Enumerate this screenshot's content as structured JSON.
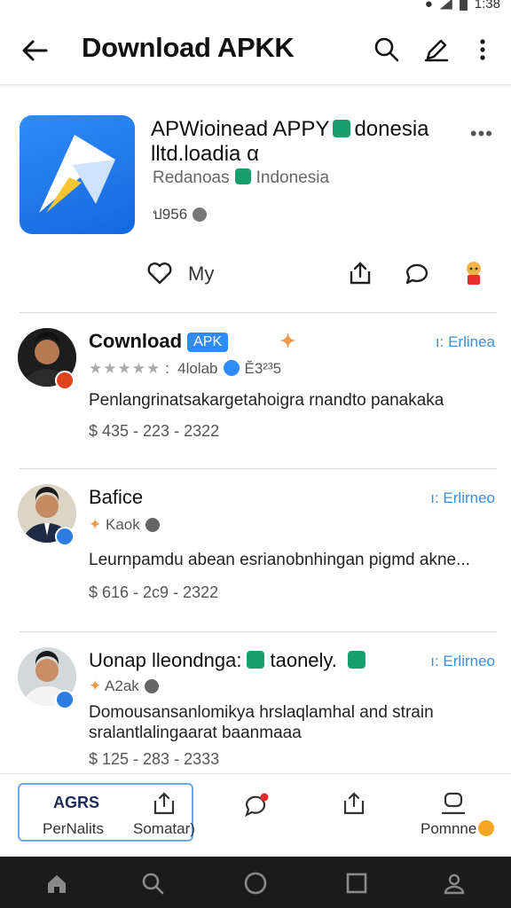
{
  "status_bar": {
    "time": "1:38"
  },
  "header": {
    "title": "Download APKK",
    "icons": [
      "back-arrow-icon",
      "search-icon",
      "edit-pen-icon",
      "more-vert-icon"
    ]
  },
  "app": {
    "name_line1": "APWioinead APPY",
    "name_line1_suffix": "donesia",
    "name_line2": "lltd.loadia α",
    "publisher": "Redanoas",
    "region": "Indonesia",
    "count": "ป956",
    "more": "•••",
    "action_my": "My"
  },
  "posts": [
    {
      "name": "Cownload",
      "pill": "APK",
      "tag": "ı: Erlinea",
      "rating_suffix": ":",
      "meta_user": "4lolab",
      "meta_count": "ง3 3",
      "meta_count_text": "Ĕ3²³5",
      "body": "Penlangrinatsakargetahoigra rnandto panakaka",
      "price": "$ 435 - 223 - 2322",
      "accent": "#e0441e"
    },
    {
      "name": "Bafice",
      "tag": "ı: Erlirneo",
      "meta_user": "Kaok",
      "body": "Leurnpamdu abean esrianobnhingan pigmd akne...",
      "price": "$ 616 - 2c9 - 2322",
      "accent": "#2f7de0"
    },
    {
      "name": "Uonap lleondnga:",
      "name_suffix": "taonely.",
      "tag": "ı: Erlirneo",
      "meta_user": "A2ak",
      "body_line1": "Domousansanlomikya hrslaqlamhal and strain",
      "body_line2": "sralantlalingaarat baanmaaa",
      "price": "$ 125 - 283 - 2333",
      "accent": "#2f7de0"
    }
  ],
  "bottom_tabs": {
    "tab1_top": "AGRS",
    "tab1_label": "PerNalits",
    "tab2_label": "Somatar)",
    "tab5_label": "Pomnne"
  },
  "colors": {
    "accent_blue": "#2f8cf6",
    "badge_green": "#18a06b",
    "tag_blue": "#3a8fd8"
  }
}
